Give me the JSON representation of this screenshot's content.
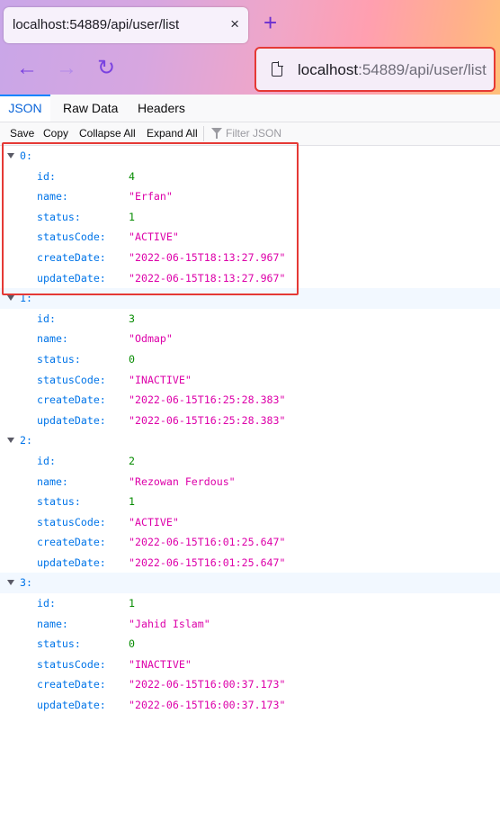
{
  "browser": {
    "tab_title": "localhost:54889/api/user/list",
    "tab_close": "×",
    "new_tab": "+",
    "url_host": "localhost",
    "url_rest": ":54889/api/user/list",
    "back_icon": "←",
    "forward_icon": "→",
    "reload_icon": "↻"
  },
  "viewer_tabs": [
    "JSON",
    "Raw Data",
    "Headers"
  ],
  "toolbar": {
    "save": "Save",
    "copy": "Copy",
    "collapse_all": "Collapse All",
    "expand_all": "Expand All",
    "filter_placeholder": "Filter JSON"
  },
  "records": [
    {
      "index": "0:",
      "fields": [
        {
          "key": "id:",
          "value": "4",
          "type": "num"
        },
        {
          "key": "name:",
          "value": "\"Erfan\"",
          "type": "str"
        },
        {
          "key": "status:",
          "value": "1",
          "type": "num"
        },
        {
          "key": "statusCode:",
          "value": "\"ACTIVE\"",
          "type": "str"
        },
        {
          "key": "createDate:",
          "value": "\"2022-06-15T18:13:27.967\"",
          "type": "str"
        },
        {
          "key": "updateDate:",
          "value": "\"2022-06-15T18:13:27.967\"",
          "type": "str"
        }
      ]
    },
    {
      "index": "1:",
      "fields": [
        {
          "key": "id:",
          "value": "3",
          "type": "num"
        },
        {
          "key": "name:",
          "value": "\"Odmap\"",
          "type": "str"
        },
        {
          "key": "status:",
          "value": "0",
          "type": "num"
        },
        {
          "key": "statusCode:",
          "value": "\"INACTIVE\"",
          "type": "str"
        },
        {
          "key": "createDate:",
          "value": "\"2022-06-15T16:25:28.383\"",
          "type": "str"
        },
        {
          "key": "updateDate:",
          "value": "\"2022-06-15T16:25:28.383\"",
          "type": "str"
        }
      ]
    },
    {
      "index": "2:",
      "fields": [
        {
          "key": "id:",
          "value": "2",
          "type": "num"
        },
        {
          "key": "name:",
          "value": "\"Rezowan Ferdous\"",
          "type": "str"
        },
        {
          "key": "status:",
          "value": "1",
          "type": "num"
        },
        {
          "key": "statusCode:",
          "value": "\"ACTIVE\"",
          "type": "str"
        },
        {
          "key": "createDate:",
          "value": "\"2022-06-15T16:01:25.647\"",
          "type": "str"
        },
        {
          "key": "updateDate:",
          "value": "\"2022-06-15T16:01:25.647\"",
          "type": "str"
        }
      ]
    },
    {
      "index": "3:",
      "fields": [
        {
          "key": "id:",
          "value": "1",
          "type": "num"
        },
        {
          "key": "name:",
          "value": "\"Jahid Islam\"",
          "type": "str"
        },
        {
          "key": "status:",
          "value": "0",
          "type": "num"
        },
        {
          "key": "statusCode:",
          "value": "\"INACTIVE\"",
          "type": "str"
        },
        {
          "key": "createDate:",
          "value": "\"2022-06-15T16:00:37.173\"",
          "type": "str"
        },
        {
          "key": "updateDate:",
          "value": "\"2022-06-15T16:00:37.173\"",
          "type": "str"
        }
      ]
    }
  ]
}
